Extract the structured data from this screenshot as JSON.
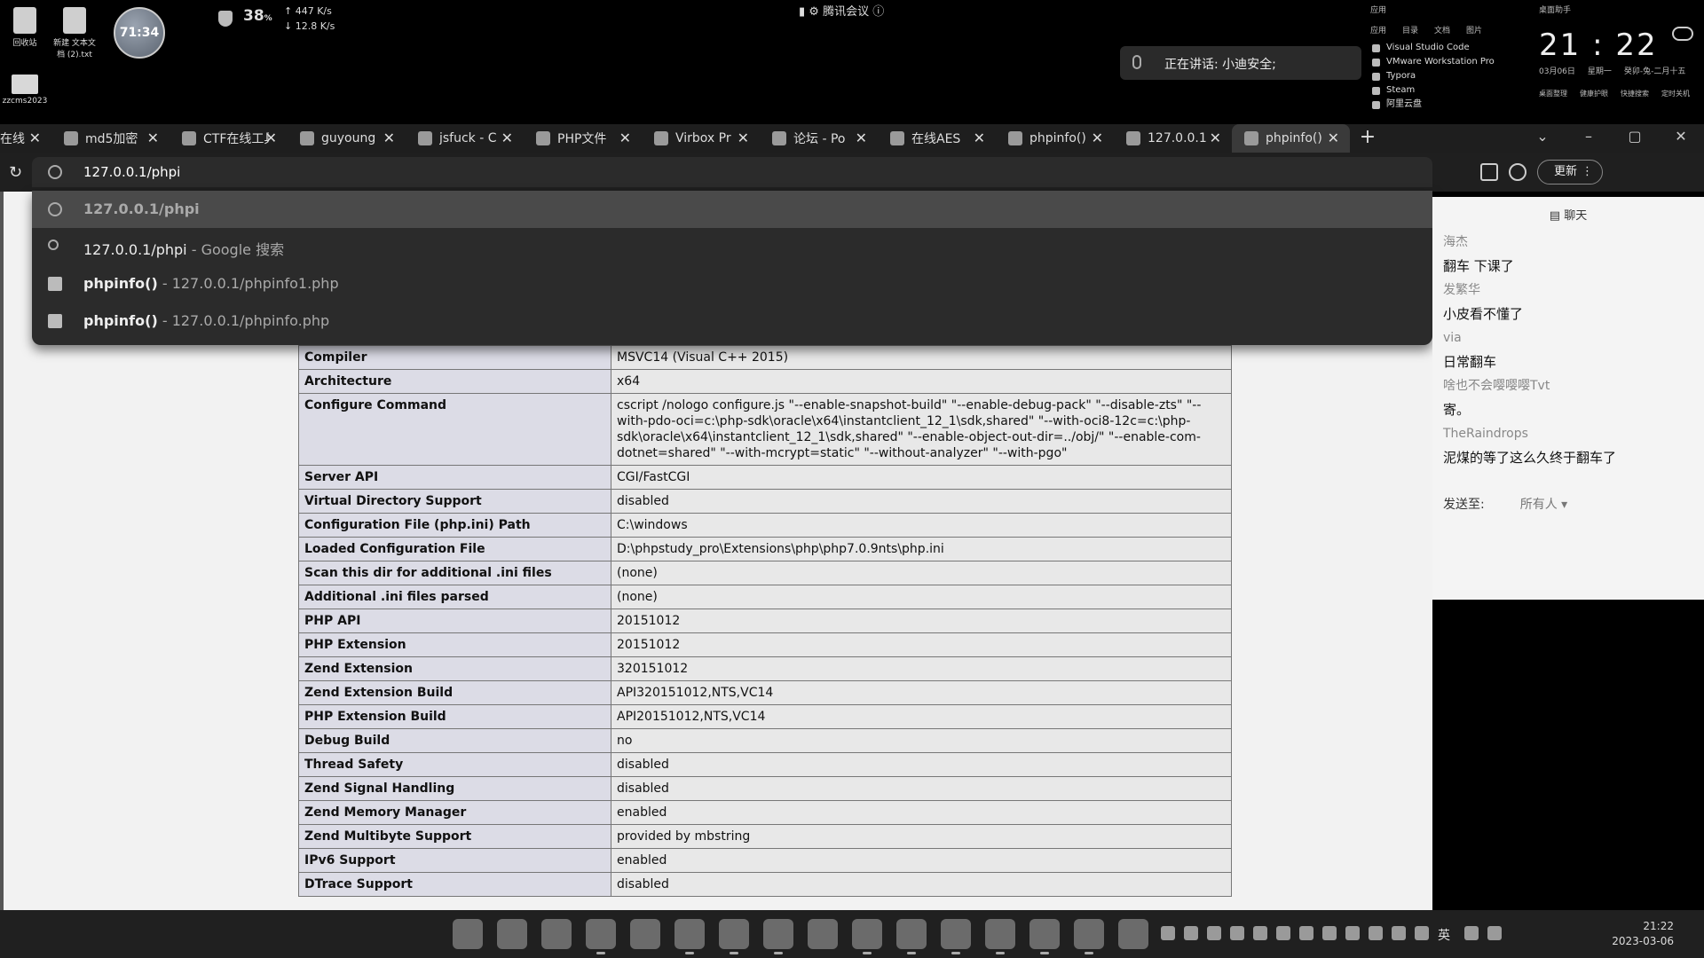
{
  "desktop": {
    "icons": [
      {
        "label": "回收站"
      },
      {
        "label": "新建 文本文档 (2).txt"
      },
      {
        "label": "zzcms2023"
      }
    ],
    "clock_badge": "71:34",
    "net": {
      "percent": "38",
      "unit": "%",
      "up": "447 K/s",
      "down": "12.8 K/s"
    },
    "meeting_title": "腾讯会议",
    "speaking": "正在讲话: 小迪安全;",
    "applist": {
      "header": "应用",
      "tabs": [
        "应用",
        "目录",
        "文档",
        "图片"
      ],
      "items": [
        "Visual Studio Code",
        "VMware Workstation Pro",
        "Typora",
        "Steam",
        "阿里云盘"
      ]
    },
    "clock_widget": {
      "label": "桌面助手",
      "time": "21 : 22",
      "date": "03月06日",
      "weekday": "星期一",
      "lunar": "癸卯-兔-二月十五",
      "actions": [
        "桌面整理",
        "健康护眼",
        "快捷搜索",
        "定时关机"
      ]
    }
  },
  "tabs": [
    {
      "title": "在线"
    },
    {
      "title": "md5加密"
    },
    {
      "title": "CTF在线工具"
    },
    {
      "title": "guyoung"
    },
    {
      "title": "jsfuck - C"
    },
    {
      "title": "PHP文件"
    },
    {
      "title": "Virbox Pr"
    },
    {
      "title": "论坛 - Po"
    },
    {
      "title": "在线AES"
    },
    {
      "title": "phpinfo()"
    },
    {
      "title": "127.0.0.1"
    },
    {
      "title": "phpinfo()"
    }
  ],
  "toolbar": {
    "url": "127.0.0.1/phpi",
    "update_label": "更新"
  },
  "suggestions": [
    {
      "bold": "127.0.0.1/phpi",
      "rest": ""
    },
    {
      "bold": "127.0.0.1/phpi",
      "rest": " - Google 搜索"
    },
    {
      "bold": "phpinfo()",
      "rest": " - 127.0.0.1/phpinfo1.php"
    },
    {
      "bold": "phpinfo()",
      "rest": " - 127.0.0.1/phpinfo.php"
    }
  ],
  "phpinfo": [
    {
      "k": "Compiler",
      "v": "MSVC14 (Visual C++ 2015)"
    },
    {
      "k": "Architecture",
      "v": "x64"
    },
    {
      "k": "Configure Command",
      "v": "cscript /nologo configure.js \"--enable-snapshot-build\" \"--enable-debug-pack\" \"--disable-zts\" \"--with-pdo-oci=c:\\php-sdk\\oracle\\x64\\instantclient_12_1\\sdk,shared\" \"--with-oci8-12c=c:\\php-sdk\\oracle\\x64\\instantclient_12_1\\sdk,shared\" \"--enable-object-out-dir=../obj/\" \"--enable-com-dotnet=shared\" \"--with-mcrypt=static\" \"--without-analyzer\" \"--with-pgo\""
    },
    {
      "k": "Server API",
      "v": "CGI/FastCGI"
    },
    {
      "k": "Virtual Directory Support",
      "v": "disabled"
    },
    {
      "k": "Configuration File (php.ini) Path",
      "v": "C:\\windows"
    },
    {
      "k": "Loaded Configuration File",
      "v": "D:\\phpstudy_pro\\Extensions\\php\\php7.0.9nts\\php.ini"
    },
    {
      "k": "Scan this dir for additional .ini files",
      "v": "(none)"
    },
    {
      "k": "Additional .ini files parsed",
      "v": "(none)"
    },
    {
      "k": "PHP API",
      "v": "20151012"
    },
    {
      "k": "PHP Extension",
      "v": "20151012"
    },
    {
      "k": "Zend Extension",
      "v": "320151012"
    },
    {
      "k": "Zend Extension Build",
      "v": "API320151012,NTS,VC14"
    },
    {
      "k": "PHP Extension Build",
      "v": "API20151012,NTS,VC14"
    },
    {
      "k": "Debug Build",
      "v": "no"
    },
    {
      "k": "Thread Safety",
      "v": "disabled"
    },
    {
      "k": "Zend Signal Handling",
      "v": "disabled"
    },
    {
      "k": "Zend Memory Manager",
      "v": "enabled"
    },
    {
      "k": "Zend Multibyte Support",
      "v": "provided by mbstring"
    },
    {
      "k": "IPv6 Support",
      "v": "enabled"
    },
    {
      "k": "DTrace Support",
      "v": "disabled"
    }
  ],
  "chat": {
    "title": "聊天",
    "messages": [
      {
        "name": "海杰",
        "text": "翻车 下课了"
      },
      {
        "name": "发繁华",
        "text": "小皮看不懂了"
      },
      {
        "name": "via",
        "text": "日常翻车"
      },
      {
        "name": "啥也不会嘤嘤嘤Tvt",
        "text": "寄。"
      },
      {
        "name": "TheRaindrops",
        "text": "泥煤的等了这么久终于翻车了"
      }
    ],
    "send_label": "发送至:",
    "send_target": "所有人"
  },
  "taskbar": {
    "lang": "英",
    "time": "21:22",
    "date": "2023-03-06"
  }
}
